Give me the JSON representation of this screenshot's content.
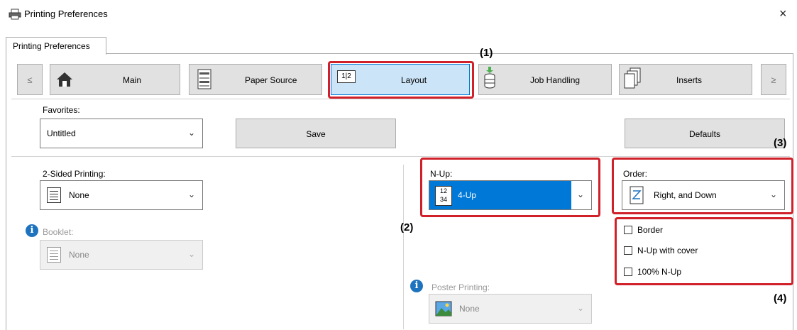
{
  "window": {
    "title": "Printing Preferences",
    "close": "×"
  },
  "tabs": [
    {
      "label": "Printing Preferences"
    }
  ],
  "nav": {
    "prev": "≤",
    "next": "≥",
    "items": [
      {
        "label": "Main",
        "icon": "home-icon"
      },
      {
        "label": "Paper Source",
        "icon": "paper-tray-icon"
      },
      {
        "label": "Layout",
        "icon": "layout-icon",
        "active": true,
        "icon_text": "1|2"
      },
      {
        "label": "Job Handling",
        "icon": "job-handling-icon"
      },
      {
        "label": "Inserts",
        "icon": "inserts-icon"
      }
    ]
  },
  "favorites": {
    "label": "Favorites:",
    "value": "Untitled",
    "save": "Save",
    "defaults": "Defaults"
  },
  "two_sided": {
    "label": "2-Sided Printing:",
    "value": "None"
  },
  "booklet": {
    "label": "Booklet:",
    "value": "None"
  },
  "nup": {
    "label": "N-Up:",
    "value": "4-Up",
    "icon_text": "12 34"
  },
  "order": {
    "label": "Order:",
    "value": "Right, and Down"
  },
  "checkboxes": [
    {
      "label": "Border",
      "checked": false
    },
    {
      "label": "N-Up with cover",
      "checked": false
    },
    {
      "label": "100% N-Up",
      "checked": false
    }
  ],
  "poster": {
    "label": "Poster Printing:",
    "value": "None"
  },
  "callouts": {
    "c1": "(1)",
    "c2": "(2)",
    "c3": "(3)",
    "c4": "(4)"
  },
  "colors": {
    "accent": "#0078d7",
    "highlight": "#d0202a",
    "active_tab": "#cce4f7"
  }
}
